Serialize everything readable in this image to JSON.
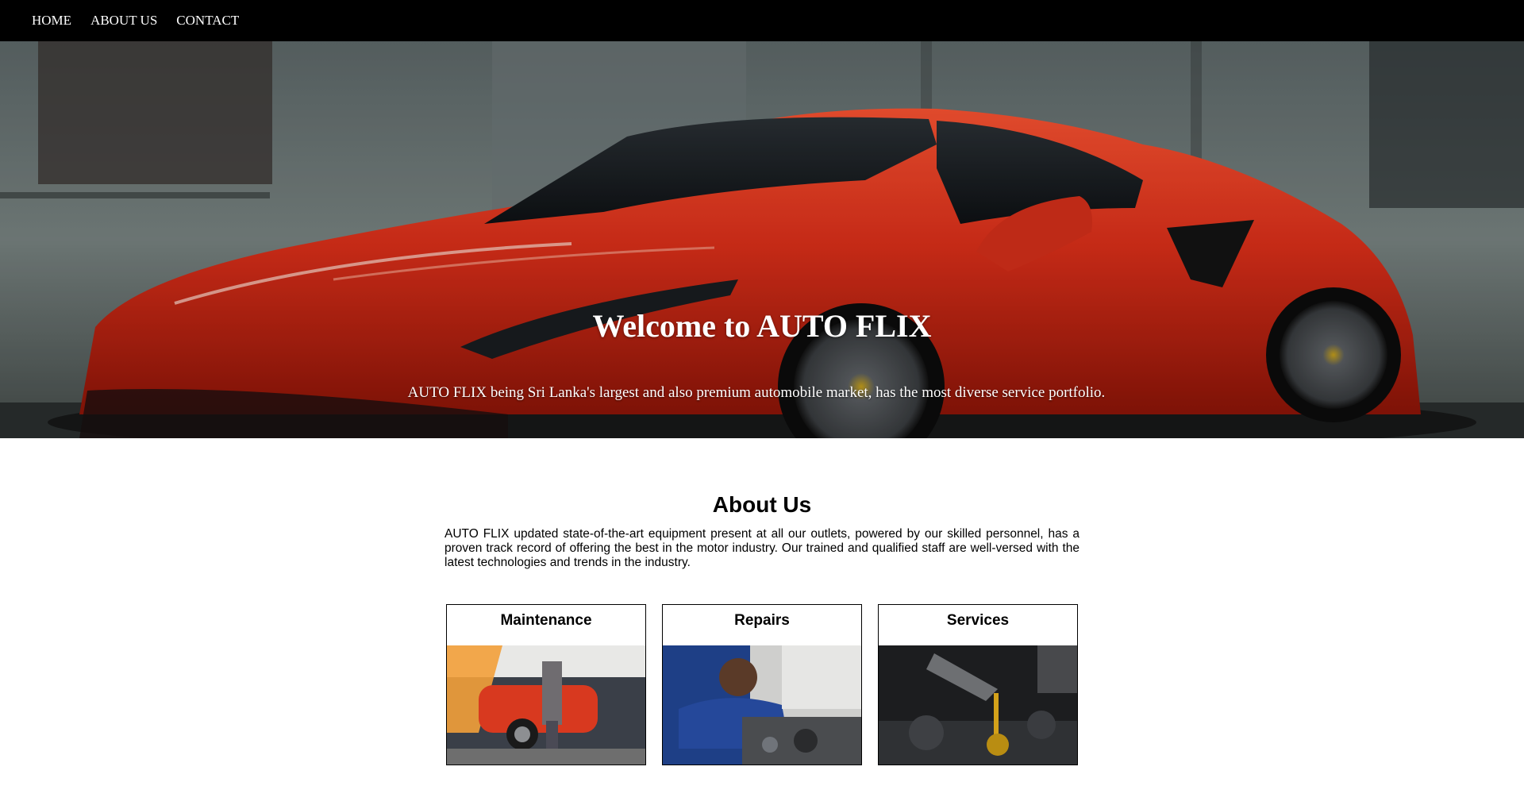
{
  "nav": {
    "items": [
      {
        "label": "HOME"
      },
      {
        "label": "ABOUT US"
      },
      {
        "label": "CONTACT"
      }
    ]
  },
  "hero": {
    "title": "Welcome to AUTO FLIX",
    "subtitle": "AUTO FLIX being Sri Lanka's largest and also premium automobile market, has the most diverse service portfolio.",
    "image": "red-sports-car-photo"
  },
  "about": {
    "heading": "About Us",
    "text": "AUTO FLIX updated state-of-the-art equipment present at all our outlets, powered by our skilled personnel, has a proven track record of offering the best in the motor industry. Our trained and qualified staff are well-versed with the latest technologies and trends in the industry."
  },
  "cards": [
    {
      "title": "Maintenance",
      "image": "garage-lift-photo"
    },
    {
      "title": "Repairs",
      "image": "mechanic-photo"
    },
    {
      "title": "Services",
      "image": "oil-change-photo"
    }
  ]
}
